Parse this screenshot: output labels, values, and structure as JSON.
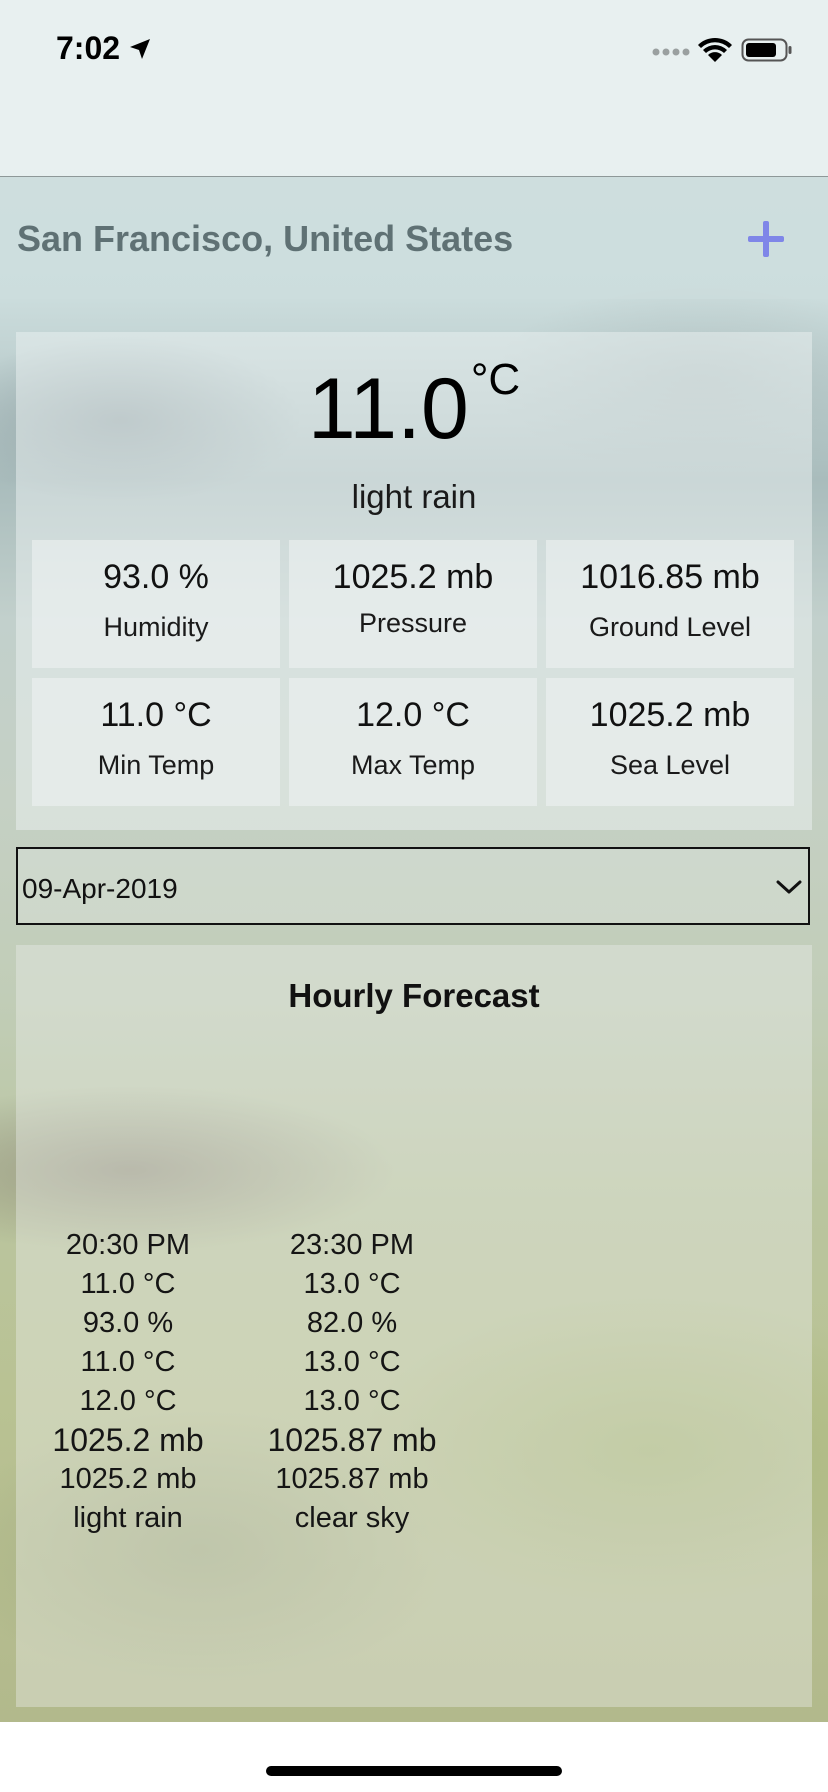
{
  "status_bar": {
    "time": "7:02",
    "icons": [
      "location-arrow-icon",
      "cellular-signal-icon",
      "wifi-icon",
      "battery-icon"
    ]
  },
  "header": {
    "city": "San Francisco, United States",
    "add_icon": "plus-icon",
    "accent_color": "#7f86e8"
  },
  "current": {
    "temperature": "11.0",
    "unit": "°C",
    "description": "light rain",
    "stats": [
      {
        "value": "93.0 %",
        "label": "Humidity"
      },
      {
        "value": "1025.2 mb",
        "label": "Pressure"
      },
      {
        "value": "1016.85 mb",
        "label": "Ground Level"
      },
      {
        "value": "11.0 °C",
        "label": "Min Temp"
      },
      {
        "value": "12.0 °C",
        "label": "Max Temp"
      },
      {
        "value": "1025.2 mb",
        "label": "Sea Level"
      }
    ]
  },
  "date_select": {
    "value": "09-Apr-2019",
    "icon": "chevron-down-icon"
  },
  "forecast": {
    "title": "Hourly Forecast",
    "hours": [
      {
        "time": "20:30 PM",
        "temp": "11.0 °C",
        "humidity": "93.0 %",
        "min_temp": "11.0 °C",
        "max_temp": "12.0 °C",
        "pressure": "1025.2 mb",
        "sea_level": "1025.2 mb",
        "description": "light rain"
      },
      {
        "time": "23:30 PM",
        "temp": "13.0 °C",
        "humidity": "82.0 %",
        "min_temp": "13.0 °C",
        "max_temp": "13.0 °C",
        "pressure": "1025.87 mb",
        "sea_level": "1025.87 mb",
        "description": "clear sky"
      }
    ]
  }
}
